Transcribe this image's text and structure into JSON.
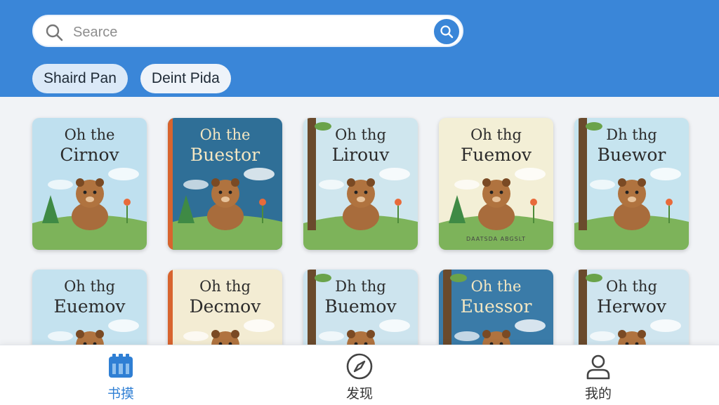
{
  "search": {
    "placeholder": "Searce"
  },
  "filters": [
    "Shaird Pan",
    "Deint Pida"
  ],
  "books": [
    {
      "t1": "Oh the",
      "t2": "Cirnov",
      "bg": "#bfe0ef",
      "dark": false,
      "sub": ""
    },
    {
      "t1": "Oh the",
      "t2": "Buestor",
      "bg": "#2f6f97",
      "dark": true,
      "sub": ""
    },
    {
      "t1": "Oh thg",
      "t2": "Lirouv",
      "bg": "#cfe6ee",
      "dark": false,
      "sub": ""
    },
    {
      "t1": "Oh thg",
      "t2": "Fuemov",
      "bg": "#f3efd6",
      "dark": false,
      "sub": "DAATSDA ABGSLT"
    },
    {
      "t1": "Dh thg",
      "t2": "Buewor",
      "bg": "#c6e4ef",
      "dark": false,
      "sub": ""
    },
    {
      "t1": "Oh thg",
      "t2": "Euemov",
      "bg": "#c4e2ef",
      "dark": false,
      "sub": ""
    },
    {
      "t1": "Oh thg",
      "t2": "Decmov",
      "bg": "#f3ecd3",
      "dark": false,
      "sub": ""
    },
    {
      "t1": "Dh thg",
      "t2": "Buemov",
      "bg": "#cde4ee",
      "dark": false,
      "sub": ""
    },
    {
      "t1": "Oh the",
      "t2": "Euessor",
      "bg": "#3a7ba8",
      "dark": true,
      "sub": ""
    },
    {
      "t1": "Oh thg",
      "t2": "Herwov",
      "bg": "#cfe5ef",
      "dark": false,
      "sub": ""
    }
  ],
  "nav": [
    {
      "label": "书摸",
      "icon": "bookshelf-icon",
      "active": true
    },
    {
      "label": "发现",
      "icon": "compass-icon",
      "active": false
    },
    {
      "label": "我的",
      "icon": "user-icon",
      "active": false
    }
  ],
  "colors": {
    "header": "#3a86d8",
    "accent": "#2f7fd4"
  }
}
